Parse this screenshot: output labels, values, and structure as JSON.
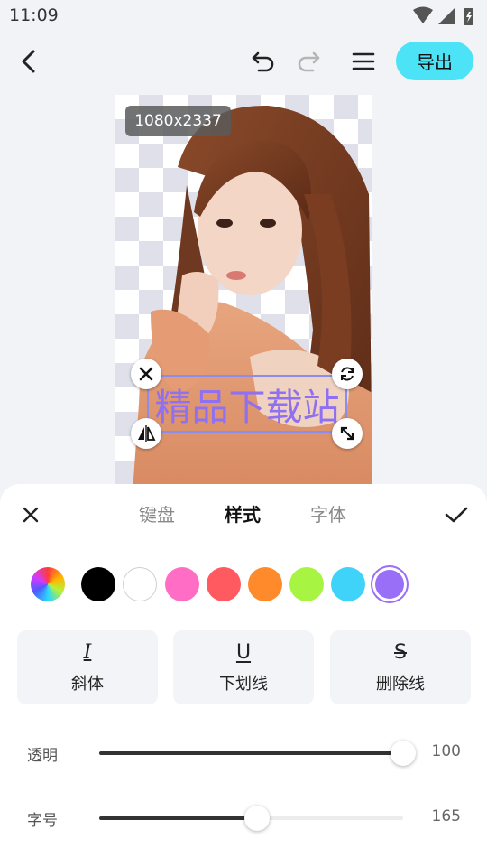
{
  "status_bar": {
    "time": "11:09"
  },
  "toolbar": {
    "export_label": "导出"
  },
  "canvas": {
    "size_label": "1080x2337",
    "overlay_text": "精品下载站"
  },
  "panel": {
    "tabs": [
      {
        "label": "键盘",
        "active": false
      },
      {
        "label": "样式",
        "active": true
      },
      {
        "label": "字体",
        "active": false
      }
    ],
    "colors": [
      "#000000",
      "#ffffff",
      "#ff6ec4",
      "#ff5a5f",
      "#ff8a2b",
      "#a7f542",
      "#3fd3fa",
      "#9a6ff7"
    ],
    "selected_color": "#9a6ff7",
    "styles": [
      {
        "glyph": "I",
        "label": "斜体"
      },
      {
        "glyph": "U",
        "label": "下划线"
      },
      {
        "glyph": "S",
        "label": "删除线"
      }
    ],
    "opacity": {
      "label": "透明",
      "value": "100",
      "fraction": 1.0
    },
    "font_size": {
      "label": "字号",
      "value": "165",
      "fraction": 0.52
    }
  }
}
